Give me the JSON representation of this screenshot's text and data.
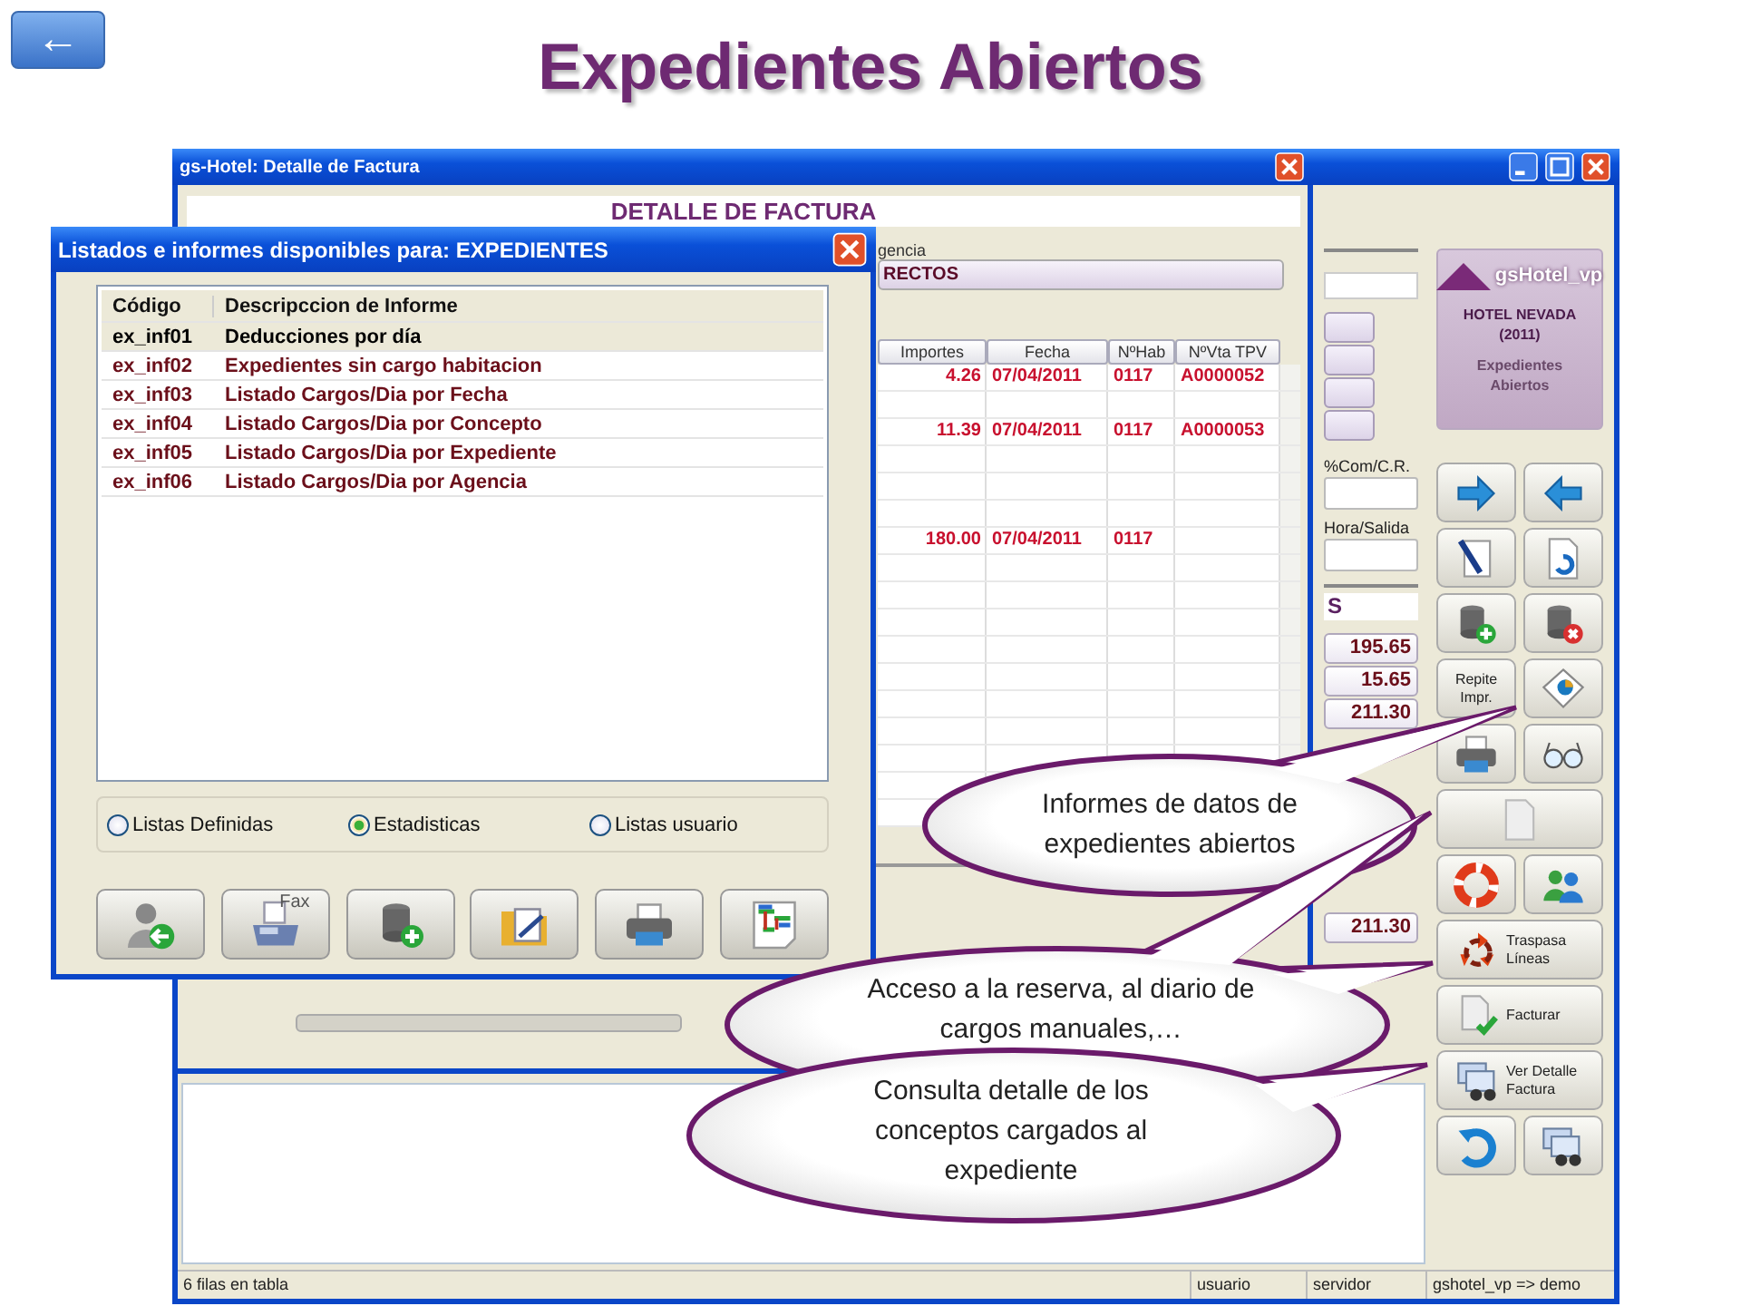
{
  "slide": {
    "back_button": "←",
    "title": "Expedientes Abiertos"
  },
  "main_window": {
    "mid_panel": {
      "com_label": "%Com/C.R.",
      "hora_label": "Hora/Salida",
      "totals_heading": "S",
      "totals": [
        "195.65",
        "15.65",
        "211.30"
      ],
      "final_total": "211.30"
    },
    "logo": {
      "brand": "gsHotel_vp",
      "hotel": "HOTEL NEVADA (2011)",
      "module": "Expedientes Abiertos"
    },
    "tool_buttons": [
      {
        "kind": "icon"
      },
      {
        "kind": "icon"
      },
      {
        "kind": "icon"
      },
      {
        "kind": "icon"
      },
      {
        "kind": "icon"
      },
      {
        "kind": "icon"
      },
      {
        "kind": "text",
        "label": "Repite Impr."
      },
      {
        "kind": "icon"
      },
      {
        "kind": "icon"
      },
      {
        "kind": "icon"
      },
      {
        "kind": "wide_icon"
      },
      {
        "kind": "icon"
      },
      {
        "kind": "icon"
      },
      {
        "kind": "wide",
        "label": "Traspasa Líneas"
      },
      {
        "kind": "wide",
        "label": "Facturar"
      },
      {
        "kind": "wide",
        "label": "Ver Detalle Factura"
      },
      {
        "kind": "icon"
      },
      {
        "kind": "icon"
      }
    ],
    "status_bar": [
      "6 filas en tabla",
      "usuario",
      "servidor",
      "gshotel_vp => demo"
    ]
  },
  "detail_window": {
    "title": "gs-Hotel: Detalle de Factura",
    "heading": "DETALLE DE FACTURA",
    "agency_label": "gencia",
    "agency_value": "RECTOS",
    "columns": [
      "Importes",
      "Fecha",
      "NºHab",
      "NºVta TPV"
    ],
    "rows": [
      {
        "cells": [
          "4.26",
          "07/04/2011",
          "0117",
          "A0000052"
        ]
      },
      {},
      {
        "cells": [
          "11.39",
          "07/04/2011",
          "0117",
          "A0000053"
        ]
      },
      {},
      {},
      {},
      {
        "cells": [
          "180.00",
          "07/04/2011",
          "0117"
        ]
      }
    ]
  },
  "reports_dialog": {
    "title": "Listados e informes disponibles para: EXPEDIENTES",
    "columns": [
      "Código",
      "Descripccion de Informe"
    ],
    "rows": [
      {
        "code": "ex_inf01",
        "description": "Deducciones por día",
        "selected": true
      },
      {
        "code": "ex_inf02",
        "description": "Expedientes sin cargo habitacion",
        "selected": false
      },
      {
        "code": "ex_inf03",
        "description": "Listado Cargos/Dia por Fecha",
        "selected": false
      },
      {
        "code": "ex_inf04",
        "description": "Listado Cargos/Dia por Concepto",
        "selected": false
      },
      {
        "code": "ex_inf05",
        "description": "Listado Cargos/Dia por Expediente",
        "selected": false
      },
      {
        "code": "ex_inf06",
        "description": "Listado Cargos/Dia por Agencia",
        "selected": false
      }
    ],
    "radios": [
      {
        "label": "Listas Definidas",
        "selected": false
      },
      {
        "label": "Estadisticas",
        "selected": true
      },
      {
        "label": "Listas usuario",
        "selected": false
      }
    ],
    "buttons": [
      {
        "kind": "icon"
      },
      {
        "kind": "labeled",
        "label": "Fax"
      },
      {
        "kind": "icon"
      },
      {
        "kind": "icon"
      },
      {
        "kind": "icon"
      },
      {
        "kind": "icon"
      }
    ]
  },
  "callouts": [
    {
      "text": "Informes de datos de expedientes abiertos"
    },
    {
      "text": "Acceso a la reserva, al diario de cargos manuales,…"
    },
    {
      "text": "Consulta detalle de los conceptos cargados al expediente"
    }
  ]
}
